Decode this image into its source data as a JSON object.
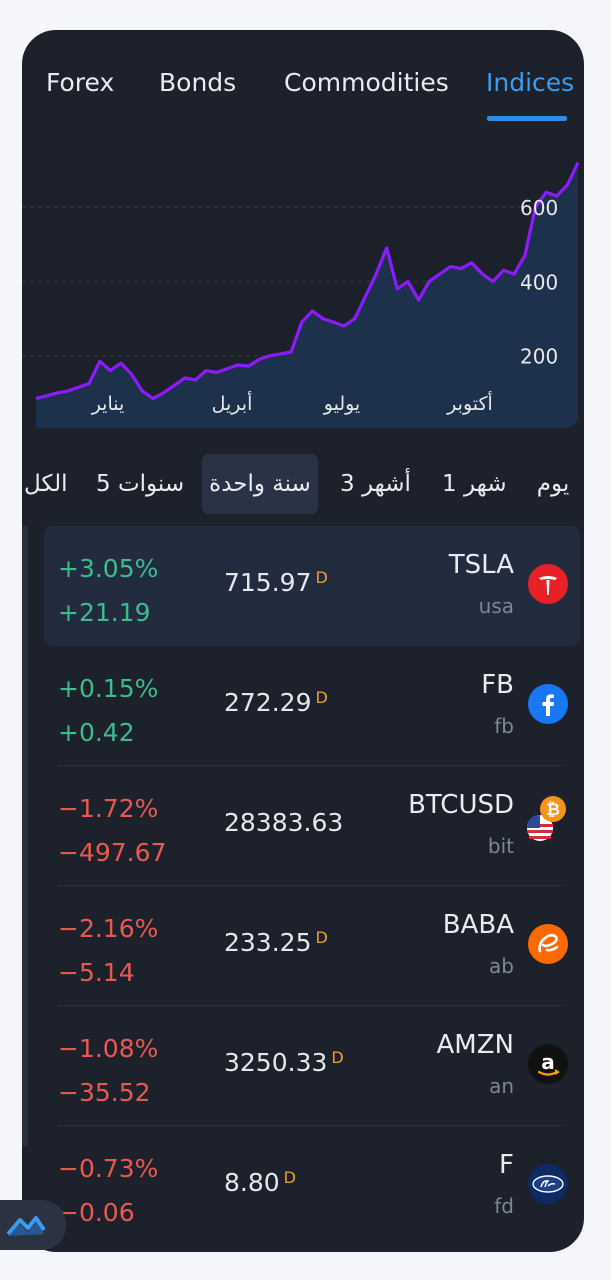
{
  "tabs": [
    {
      "label": "Forex",
      "active": false
    },
    {
      "label": "Bonds",
      "active": false
    },
    {
      "label": "Commodities",
      "active": false
    },
    {
      "label": "Indices",
      "active": true
    }
  ],
  "chart_data": {
    "type": "area",
    "title": "",
    "xlabel": "",
    "ylabel": "",
    "x_tick_labels": [
      "يناير",
      "أبريل",
      "يوليو",
      "أكتوبر"
    ],
    "y_ticks": [
      200,
      400,
      600
    ],
    "ylim": [
      0,
      700
    ],
    "grid": true,
    "series": [
      {
        "color": "#8e1bff",
        "values": [
          85,
          92,
          100,
          105,
          115,
          125,
          185,
          160,
          180,
          150,
          105,
          85,
          100,
          120,
          140,
          135,
          160,
          155,
          165,
          175,
          172,
          190,
          200,
          205,
          210,
          290,
          320,
          300,
          290,
          280,
          300,
          360,
          420,
          490,
          380,
          400,
          350,
          400,
          420,
          440,
          435,
          450,
          420,
          400,
          430,
          420,
          470,
          600,
          640,
          630,
          660,
          720
        ]
      }
    ]
  },
  "ranges": [
    {
      "label": "الكل",
      "active": false
    },
    {
      "label": "5 سنوات",
      "active": false
    },
    {
      "label": "سنة واحدة",
      "active": true
    },
    {
      "label": "3 أشهر",
      "active": false
    },
    {
      "label": "1 شهر",
      "active": false
    },
    {
      "label": "يوم",
      "active": false
    }
  ],
  "rows": [
    {
      "symbol": "TSLA",
      "sub": "usa",
      "price": "715.97",
      "badge": "D",
      "pct": "+3.05%",
      "chg": "+21.19",
      "dir": "up",
      "logo": "tesla-icon",
      "color": "#e82127"
    },
    {
      "symbol": "FB",
      "sub": "fb",
      "price": "272.29",
      "badge": "D",
      "pct": "+0.15%",
      "chg": "+0.42",
      "dir": "up",
      "logo": "facebook-icon",
      "color": "#1877f2"
    },
    {
      "symbol": "BTCUSD",
      "sub": "bit",
      "price": "28383.63",
      "badge": "",
      "pct": "−1.72%",
      "chg": "−497.67",
      "dir": "down",
      "logo": "bitcoin-usd-icon",
      "color": "#f7931a"
    },
    {
      "symbol": "BABA",
      "sub": "ab",
      "price": "233.25",
      "badge": "D",
      "pct": "−2.16%",
      "chg": "−5.14",
      "dir": "down",
      "logo": "alibaba-icon",
      "color": "#ff6a00"
    },
    {
      "symbol": "AMZN",
      "sub": "an",
      "price": "3250.33",
      "badge": "D",
      "pct": "−1.08%",
      "chg": "−35.52",
      "dir": "down",
      "logo": "amazon-icon",
      "color": "#111111"
    },
    {
      "symbol": "F",
      "sub": "fd",
      "price": "8.80",
      "badge": "D",
      "pct": "−0.73%",
      "chg": "−0.06",
      "dir": "down",
      "logo": "ford-icon",
      "color": "#0e2a63"
    }
  ]
}
